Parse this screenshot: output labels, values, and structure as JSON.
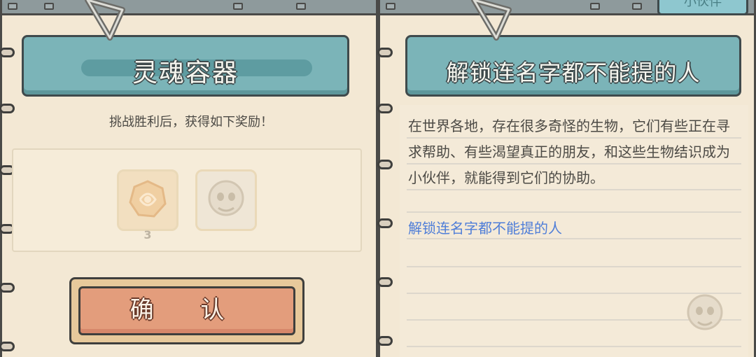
{
  "left": {
    "title": "灵魂容器",
    "reward_intro": "挑战胜利后，获得如下奖励！",
    "rewards": [
      {
        "icon": "soul-stone-icon",
        "count": "3"
      },
      {
        "icon": "ghost-creature-icon"
      }
    ],
    "confirm_label": "确 认"
  },
  "right": {
    "tab_label": "小伙伴",
    "title": "解锁连名字都不能提的人",
    "description": "在世界各地，存在很多奇怪的生物，它们有些正在寻求帮助、有些渴望真正的朋友，和这些生物结识成为小伙伴，就能得到它们的协助。",
    "link_text": "解锁连名字都不能提的人"
  }
}
